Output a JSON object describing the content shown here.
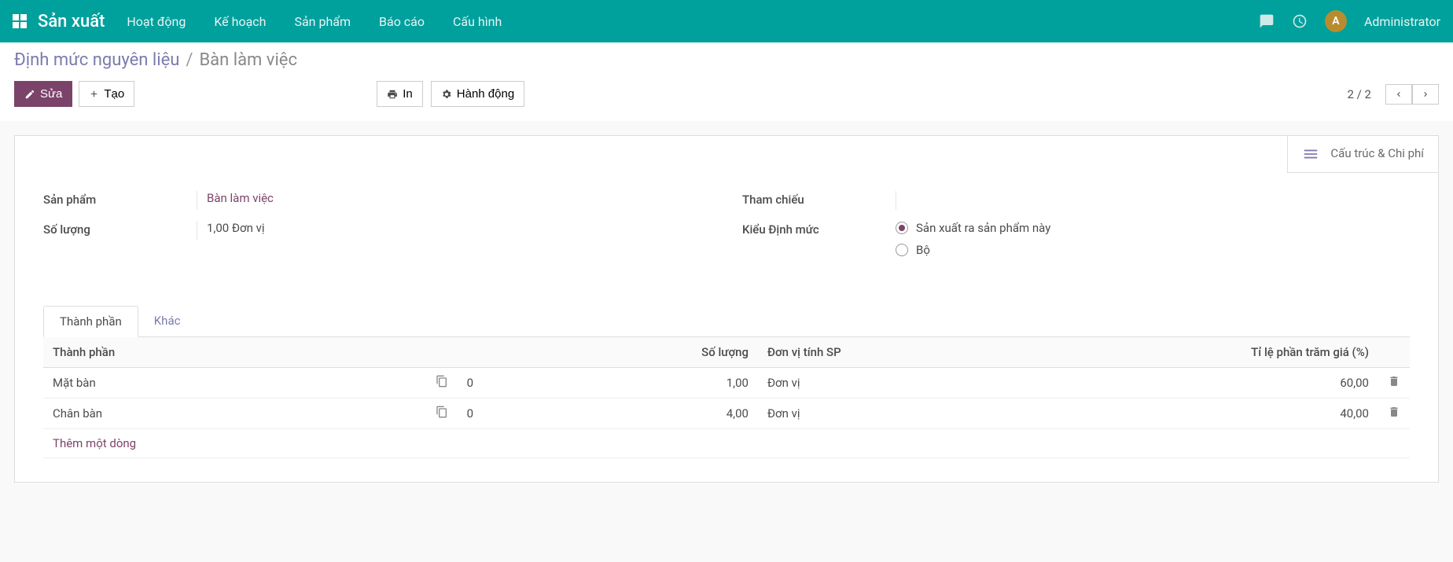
{
  "nav": {
    "brand": "Sản xuất",
    "items": [
      "Hoạt động",
      "Kế hoạch",
      "Sản phẩm",
      "Báo cáo",
      "Cấu hình"
    ],
    "user_initial": "A",
    "username": "Administrator"
  },
  "breadcrumb": {
    "parent": "Định mức nguyên liệu",
    "sep": "/",
    "current": "Bàn làm việc"
  },
  "toolbar": {
    "edit": "Sửa",
    "create": "Tạo",
    "print": "In",
    "action": "Hành động",
    "pager": "2 / 2"
  },
  "statbutton": {
    "label": "Cấu trúc & Chi phí"
  },
  "form": {
    "left": {
      "product_label": "Sản phẩm",
      "product_value": "Bàn làm việc",
      "qty_label": "Số lượng",
      "qty_value": "1,00 Đơn vị"
    },
    "right": {
      "ref_label": "Tham chiếu",
      "ref_value": "",
      "type_label": "Kiểu Định mức",
      "type_opt1": "Sản xuất ra sản phẩm này",
      "type_opt2": "Bộ"
    }
  },
  "tabs": {
    "tab1": "Thành phần",
    "tab2": "Khác"
  },
  "table": {
    "headers": {
      "component": "Thành phần",
      "qty": "Số lượng",
      "uom": "Đơn vị tính SP",
      "cost_pct": "Tỉ lệ phần trăm giá (%)"
    },
    "rows": [
      {
        "component": "Mặt bàn",
        "extra": "0",
        "qty": "1,00",
        "uom": "Đơn vị",
        "cost": "60,00"
      },
      {
        "component": "Chân bàn",
        "extra": "0",
        "qty": "4,00",
        "uom": "Đơn vị",
        "cost": "40,00"
      }
    ],
    "add_line": "Thêm một dòng"
  }
}
